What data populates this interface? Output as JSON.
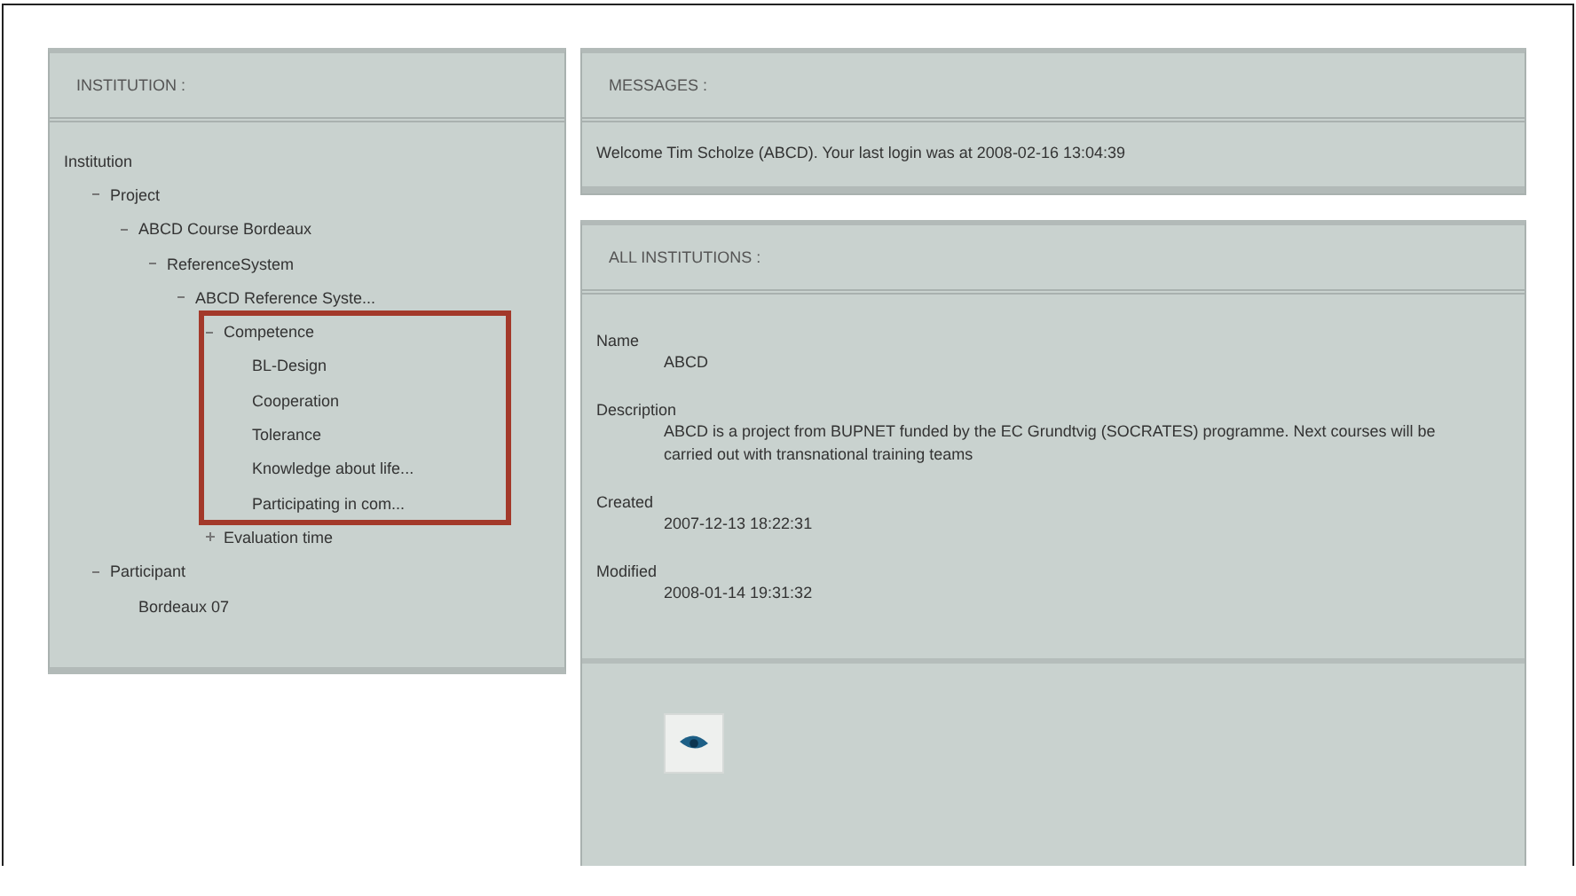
{
  "institution_panel": {
    "title": "INSTITUTION :",
    "tree": [
      {
        "label": "Institution",
        "children": [
          {
            "label": "Project",
            "expanded": true,
            "children": [
              {
                "label": "ABCD Course Bordeaux",
                "expanded": true,
                "children": [
                  {
                    "label": "ReferenceSystem",
                    "expanded": true,
                    "children": [
                      {
                        "label": "ABCD Reference Syste...",
                        "expanded": true,
                        "children": [
                          {
                            "label": "Competence",
                            "expanded": true,
                            "children": [
                              {
                                "label": "BL-Design"
                              },
                              {
                                "label": "Cooperation"
                              },
                              {
                                "label": "Tolerance"
                              },
                              {
                                "label": "Knowledge about life..."
                              },
                              {
                                "label": "Participating in com..."
                              }
                            ]
                          },
                          {
                            "label": "Evaluation time",
                            "expanded": false
                          }
                        ]
                      }
                    ]
                  }
                ]
              }
            ]
          },
          {
            "label": "Participant",
            "expanded": true,
            "children": [
              {
                "label": "Bordeaux 07"
              }
            ]
          }
        ]
      }
    ]
  },
  "messages_panel": {
    "title": "MESSAGES :",
    "text": "Welcome Tim Scholze (ABCD). Your last login was at 2008-02-16 13:04:39"
  },
  "institutions_panel": {
    "title": "ALL INSTITUTIONS :",
    "fields": [
      {
        "label": "Name",
        "value": "ABCD"
      },
      {
        "label": "Description",
        "value": "ABCD is a project from BUPNET funded by the EC Grundtvig (SOCRATES) programme. Next courses will be carried out with transnational training teams"
      },
      {
        "label": "Created",
        "value": "2007-12-13 18:22:31"
      },
      {
        "label": "Modified",
        "value": "2008-01-14 19:31:32"
      }
    ]
  }
}
